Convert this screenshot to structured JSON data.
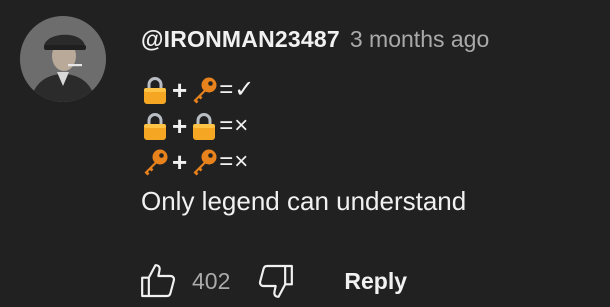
{
  "comment": {
    "author": "@IRONMAN23487",
    "time": "3 months ago",
    "lines": [
      {
        "a": "lock-icon",
        "op": "+",
        "b": "key-icon",
        "eq": "=",
        "result": "✓"
      },
      {
        "a": "lock-icon",
        "op": "+",
        "b": "lock-icon",
        "eq": "=",
        "result": "×"
      },
      {
        "a": "key-icon",
        "op": "+",
        "b": "key-icon",
        "eq": "=",
        "result": "×"
      }
    ],
    "text": "Only legend can understand"
  },
  "actions": {
    "like_count": "402",
    "reply_label": "Reply"
  },
  "colors": {
    "background": "#212121",
    "text": "#f1f1f1",
    "secondary": "#aaaaaa",
    "lock": "#f5a623",
    "key": "#e8821c"
  }
}
